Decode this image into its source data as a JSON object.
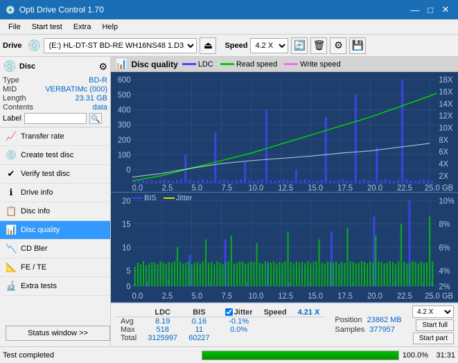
{
  "window": {
    "title": "Opti Drive Control 1.70",
    "icon": "💿",
    "controls": {
      "minimize": "—",
      "maximize": "□",
      "close": "✕"
    }
  },
  "menu": {
    "items": [
      "File",
      "Start test",
      "Extra",
      "Help"
    ]
  },
  "toolbar": {
    "drive_label": "Drive",
    "drive_value": "(E:)  HL-DT-ST BD-RE  WH16NS48 1.D3",
    "speed_label": "Speed",
    "speed_value": "4.2 X"
  },
  "disc": {
    "header": "Disc",
    "type_label": "Type",
    "type_value": "BD-R",
    "mid_label": "MID",
    "mid_value": "VERBATIMc (000)",
    "length_label": "Length",
    "length_value": "23.31 GB",
    "contents_label": "Contents",
    "contents_value": "data",
    "label_label": "Label"
  },
  "nav": {
    "items": [
      {
        "id": "transfer-rate",
        "label": "Transfer rate",
        "icon": "📈"
      },
      {
        "id": "create-test-disc",
        "label": "Create test disc",
        "icon": "💿"
      },
      {
        "id": "verify-test-disc",
        "label": "Verify test disc",
        "icon": "✔"
      },
      {
        "id": "drive-info",
        "label": "Drive info",
        "icon": "ℹ"
      },
      {
        "id": "disc-info",
        "label": "Disc info",
        "icon": "📋"
      },
      {
        "id": "disc-quality",
        "label": "Disc quality",
        "icon": "📊",
        "active": true
      },
      {
        "id": "cd-bler",
        "label": "CD Bler",
        "icon": "📉"
      },
      {
        "id": "fe-te",
        "label": "FE / TE",
        "icon": "📐"
      },
      {
        "id": "extra-tests",
        "label": "Extra tests",
        "icon": "🔬"
      }
    ],
    "status_btn": "Status window >>"
  },
  "content": {
    "title": "Disc quality",
    "legend": [
      {
        "id": "ldc",
        "label": "LDC",
        "color": "#4444ff"
      },
      {
        "id": "read-speed",
        "label": "Read speed",
        "color": "#00cc00"
      },
      {
        "id": "write-speed",
        "label": "Write speed",
        "color": "#ff66ff"
      }
    ],
    "chart1": {
      "y_left": [
        "600",
        "500",
        "400",
        "300",
        "200",
        "100",
        "0"
      ],
      "y_right": [
        "18X",
        "16X",
        "14X",
        "12X",
        "10X",
        "8X",
        "6X",
        "4X",
        "2X"
      ],
      "x": [
        "0.0",
        "2.5",
        "5.0",
        "7.5",
        "10.0",
        "12.5",
        "15.0",
        "17.5",
        "20.0",
        "22.5",
        "25.0 GB"
      ]
    },
    "chart2": {
      "title_legend": [
        {
          "id": "bis",
          "label": "BIS",
          "color": "#4444ff"
        },
        {
          "id": "jitter",
          "label": "Jitter",
          "color": "#dddd00"
        }
      ],
      "y_left": [
        "20",
        "15",
        "10",
        "5",
        "0"
      ],
      "y_right": [
        "10%",
        "8%",
        "6%",
        "4%",
        "2%"
      ],
      "x": [
        "0.0",
        "2.5",
        "5.0",
        "7.5",
        "10.0",
        "12.5",
        "15.0",
        "17.5",
        "20.0",
        "22.5",
        "25.0 GB"
      ]
    }
  },
  "stats": {
    "columns": [
      "LDC",
      "BIS"
    ],
    "jitter_label": "Jitter",
    "jitter_checked": true,
    "speed_label": "Speed",
    "speed_value": "4.21 X",
    "speed_select": "4.2 X",
    "rows": [
      {
        "label": "Avg",
        "ldc": "8.19",
        "bis": "0.16",
        "jitter": "-0.1%"
      },
      {
        "label": "Max",
        "ldc": "518",
        "bis": "11",
        "jitter": "0.0%"
      },
      {
        "label": "Total",
        "ldc": "3125997",
        "bis": "60227",
        "jitter": ""
      }
    ],
    "position_label": "Position",
    "position_value": "23862 MB",
    "samples_label": "Samples",
    "samples_value": "377957",
    "btn_start_full": "Start full",
    "btn_start_part": "Start part"
  },
  "status_bar": {
    "text": "Test completed",
    "progress": 100,
    "progress_text": "100.0%",
    "time": "31:31"
  }
}
